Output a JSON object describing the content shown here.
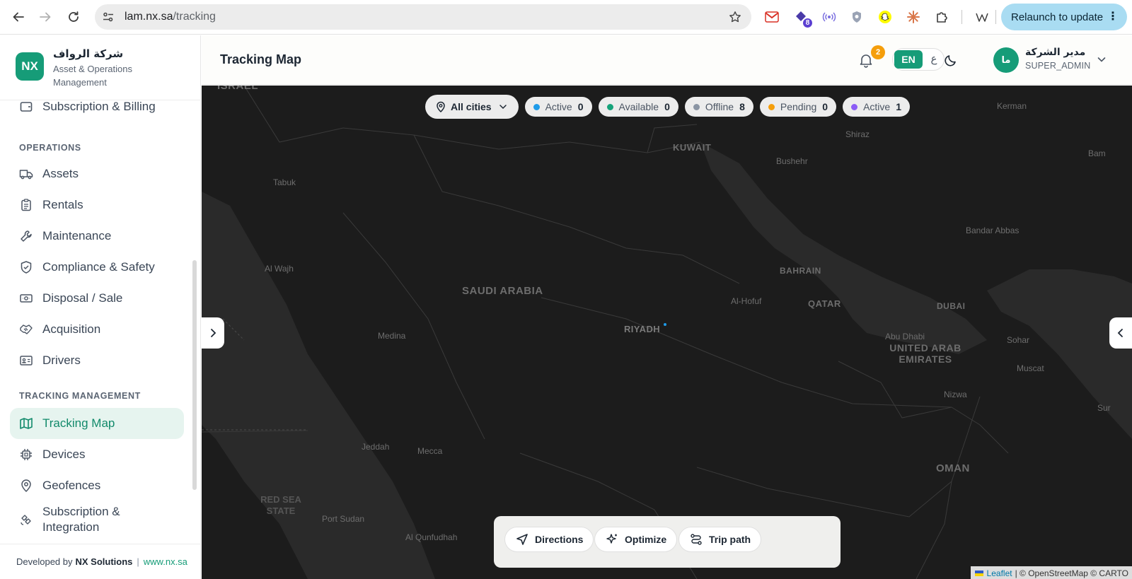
{
  "browser": {
    "url_host": "lam.nx.sa",
    "url_path": "/tracking",
    "extension_badge": "8",
    "relaunch_label": "Relaunch to update"
  },
  "brand": {
    "logo_text": "NX",
    "name": "شركة الرواف",
    "subtitle": "Asset & Operations Management"
  },
  "sidebar": {
    "top_item": "Subscription & Billing",
    "operations_title": "OPERATIONS",
    "operations": [
      {
        "label": "Assets",
        "icon": "truck-icon"
      },
      {
        "label": "Rentals",
        "icon": "clipboard-icon"
      },
      {
        "label": "Maintenance",
        "icon": "wrench-icon"
      },
      {
        "label": "Compliance & Safety",
        "icon": "shield-icon"
      },
      {
        "label": "Disposal / Sale",
        "icon": "banknote-icon"
      },
      {
        "label": "Acquisition",
        "icon": "handshake-icon"
      },
      {
        "label": "Drivers",
        "icon": "id-card-icon"
      }
    ],
    "tracking_title": "TRACKING MANAGEMENT",
    "tracking": [
      {
        "label": "Tracking Map",
        "icon": "map-icon",
        "active": true
      },
      {
        "label": "Devices",
        "icon": "chip-icon"
      },
      {
        "label": "Geofences",
        "icon": "pin-icon"
      },
      {
        "label": "Subscription & Integration",
        "icon": "satellite-icon"
      }
    ],
    "footer": {
      "prefix": "Developed by",
      "company": "NX Solutions",
      "separator": "|",
      "website": "www.nx.sa"
    }
  },
  "header": {
    "title": "Tracking Map",
    "notification_count": "2",
    "lang_en": "EN",
    "lang_ar": "ع",
    "user_initials": "ما",
    "user_name": "مدير الشركة",
    "user_role": "SUPER_ADMIN"
  },
  "filters": {
    "city_select": "All cities",
    "chips": [
      {
        "label": "Active",
        "count": "0",
        "color": "#1e9be9"
      },
      {
        "label": "Available",
        "count": "0",
        "color": "#16a37a"
      },
      {
        "label": "Offline",
        "count": "8",
        "color": "#8a94a3"
      },
      {
        "label": "Pending",
        "count": "0",
        "color": "#f59e0b"
      },
      {
        "label": "Active",
        "count": "1",
        "color": "#8b5cf6"
      }
    ]
  },
  "map": {
    "labels": {
      "israel": "ISRAEL",
      "kuwait": "KUWAIT",
      "kerman": "Kerman",
      "shiraz": "Shiraz",
      "bam": "Bam",
      "bushehr": "Bushehr",
      "tabuk": "Tabuk",
      "bandar_abbas": "Bandar Abbas",
      "al_wajh": "Al Wajh",
      "saudi_arabia": "SAUDI ARABIA",
      "bahrain": "BAHRAIN",
      "al_hofuf": "Al-Hofuf",
      "qatar": "QATAR",
      "dubai": "DUBAI",
      "medina": "Medina",
      "riyadh": "RIYADH",
      "abu_dhabi": "Abu Dhabi",
      "uae": "UNITED ARAB EMIRATES",
      "sohar": "Sohar",
      "muscat": "Muscat",
      "nizwa": "Nizwa",
      "sur": "Sur",
      "jeddah": "Jeddah",
      "mecca": "Mecca",
      "oman": "OMAN",
      "red_sea_state": "RED SEA STATE",
      "port_sudan": "Port Sudan",
      "al_qunfudhah": "Al Qunfudhah"
    },
    "attribution_leaflet": "Leaflet",
    "attribution_rest": "| © OpenStreetMap © CARTO"
  },
  "tools": {
    "directions": "Directions",
    "optimize": "Optimize",
    "trip_path": "Trip path"
  }
}
